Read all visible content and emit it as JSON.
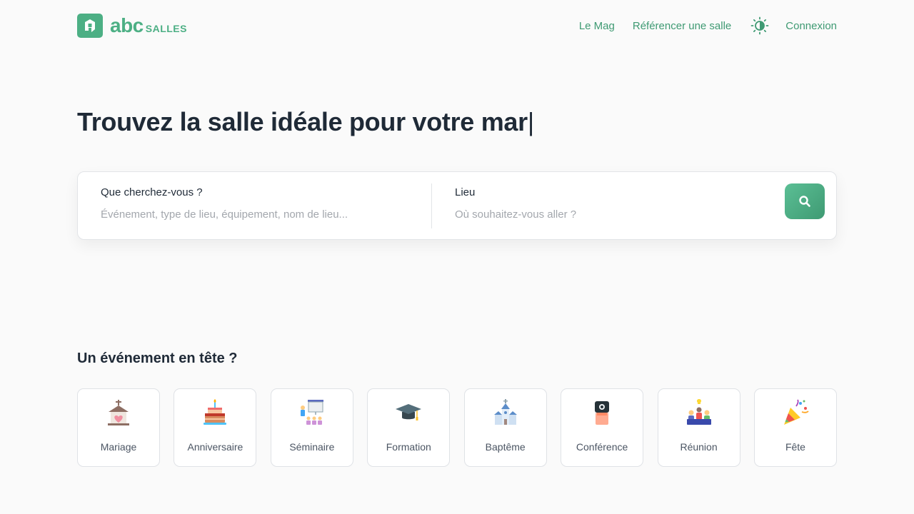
{
  "header": {
    "logo": {
      "abc": "abc",
      "salles": "SALLES"
    },
    "nav": {
      "mag": "Le Mag",
      "referencer": "Référencer une salle",
      "connexion": "Connexion"
    },
    "theme_icon": "sun-half-icon"
  },
  "hero": {
    "title": "Trouvez la salle idéale pour votre mar",
    "caret": "|"
  },
  "search": {
    "what_label": "Que cherchez-vous ?",
    "what_placeholder": "Événement, type de lieu, équipement, nom de lieu...",
    "where_label": "Lieu",
    "where_placeholder": "Où souhaitez-vous aller ?",
    "button_icon": "search-icon"
  },
  "events": {
    "title": "Un événement en tête ?",
    "items": [
      {
        "label": "Mariage",
        "icon": "chapel-icon"
      },
      {
        "label": "Anniversaire",
        "icon": "cake-icon"
      },
      {
        "label": "Séminaire",
        "icon": "presentation-icon"
      },
      {
        "label": "Formation",
        "icon": "graduation-cap-icon"
      },
      {
        "label": "Baptême",
        "icon": "church-icon"
      },
      {
        "label": "Conférence",
        "icon": "speaker-icon"
      },
      {
        "label": "Réunion",
        "icon": "meeting-icon"
      },
      {
        "label": "Fête",
        "icon": "party-popper-icon"
      }
    ]
  },
  "colors": {
    "brand": "#4caf84",
    "nav_link": "#3f9a73",
    "text_dark": "#1f2a37",
    "background": "#fafafa"
  }
}
